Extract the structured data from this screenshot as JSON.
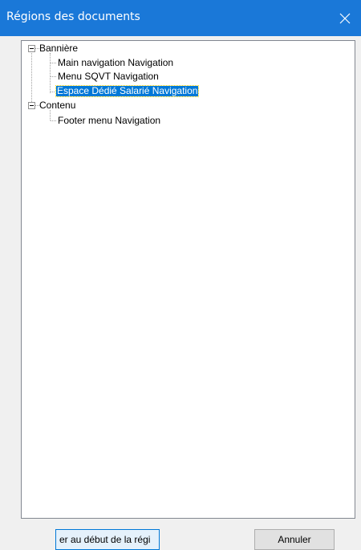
{
  "window": {
    "title": "Régions des documents",
    "close_icon": "close-icon",
    "accent_color": "#1a78d8"
  },
  "tree": {
    "groups": [
      {
        "label": "Bannière",
        "expanded": true,
        "children": [
          {
            "label": "Main navigation Navigation",
            "selected": false
          },
          {
            "label": "Menu SQVT Navigation",
            "selected": false
          },
          {
            "label": "Espace Dédié Salarié Navigation",
            "selected": true
          }
        ]
      },
      {
        "label": "Contenu",
        "expanded": true,
        "children": [
          {
            "label": "Footer menu Navigation",
            "selected": false
          }
        ]
      }
    ],
    "selection_color": "#0078d7"
  },
  "buttons": {
    "move_label": "er au début de la régi",
    "cancel_label": "Annuler"
  }
}
